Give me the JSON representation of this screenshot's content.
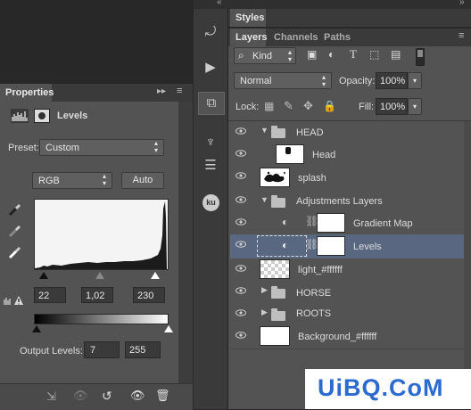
{
  "collapse_icons": {
    "left": "«",
    "right": "»"
  },
  "properties": {
    "tab": "Properties",
    "title": "Levels",
    "preset_label": "Preset:",
    "preset_value": "Custom",
    "channel_value": "RGB",
    "auto_label": "Auto",
    "input_black": "22",
    "input_gamma": "1,02",
    "input_white": "230",
    "output_label": "Output Levels:",
    "output_black": "7",
    "output_white": "255"
  },
  "styles_tab": "Styles",
  "layers_panel": {
    "tabs": [
      "Layers",
      "Channels",
      "Paths"
    ],
    "filter_kind": "Kind",
    "blend_mode": "Normal",
    "opacity_label": "Opacity:",
    "opacity_value": "100%",
    "lock_label": "Lock:",
    "fill_label": "Fill:",
    "fill_value": "100%",
    "layers": [
      {
        "name": "HEAD"
      },
      {
        "name": "Head"
      },
      {
        "name": "splash"
      },
      {
        "name": "Adjustments Layers"
      },
      {
        "name": "Gradient Map"
      },
      {
        "name": "Levels"
      },
      {
        "name": "light_#ffffff"
      },
      {
        "name": "HORSE"
      },
      {
        "name": "ROOTS"
      },
      {
        "name": "Background_#ffffff"
      }
    ]
  },
  "toolbar_ku_label": "ku",
  "watermark": "UiBQ.CoM",
  "colors": {
    "panel": "#535353",
    "selected_row": "#596781",
    "watermark": "#2a6ad1"
  }
}
